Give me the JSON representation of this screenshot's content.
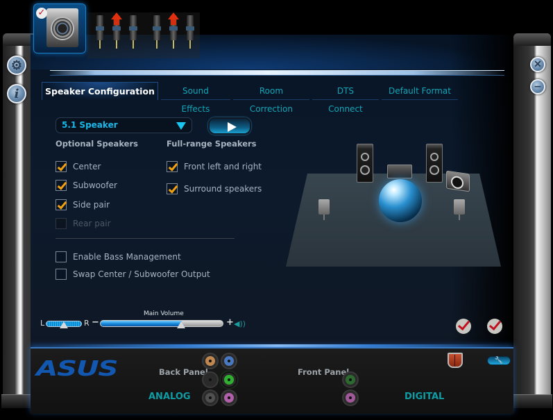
{
  "window": {
    "side_buttons_left": [
      {
        "name": "settings",
        "icon": "gear-icon",
        "glyph": "⚙"
      },
      {
        "name": "info",
        "icon": "info-icon",
        "glyph": "i"
      }
    ],
    "side_buttons_right": [
      {
        "name": "close",
        "icon": "close-icon",
        "glyph": "✕"
      },
      {
        "name": "minimize",
        "icon": "minimize-icon",
        "glyph": "−"
      }
    ]
  },
  "device": {
    "selected": "Speakers",
    "check_glyph": "✓",
    "jacks": [
      {
        "arrow": false
      },
      {
        "arrow": true
      },
      {
        "arrow": false
      },
      {
        "arrow": false
      },
      {
        "arrow": true
      },
      {
        "arrow": false
      }
    ]
  },
  "tabs": [
    {
      "label": "Speaker Configuration",
      "active": true
    },
    {
      "label": "Sound Effects",
      "active": false
    },
    {
      "label": "Room Correction",
      "active": false
    },
    {
      "label": "DTS Connect",
      "active": false
    },
    {
      "label": "Default Format",
      "active": false
    }
  ],
  "config": {
    "speaker_mode": "5.1 Speaker",
    "test_button": "play",
    "optional_heading": "Optional Speakers",
    "fullrange_heading": "Full-range Speakers",
    "optional": [
      {
        "label": "Center",
        "checked": true,
        "disabled": false
      },
      {
        "label": "Subwoofer",
        "checked": true,
        "disabled": false
      },
      {
        "label": "Side pair",
        "checked": true,
        "disabled": false
      },
      {
        "label": "Rear pair",
        "checked": false,
        "disabled": true
      }
    ],
    "fullrange": [
      {
        "label": "Front left and right",
        "checked": true
      },
      {
        "label": "Surround speakers",
        "checked": true
      }
    ],
    "options": [
      {
        "label": "Enable Bass Management",
        "checked": false
      },
      {
        "label": "Swap Center / Subwoofer Output",
        "checked": false
      }
    ]
  },
  "volume": {
    "balance_left": "L",
    "balance_right": "R",
    "balance_value": 0.5,
    "main_label": "Main Volume",
    "main_value": 0.66,
    "minus": "−",
    "plus": "+",
    "speaker_glyph": "◀))"
  },
  "bottom": {
    "brand": "ASUS",
    "back_panel": "Back Panel",
    "front_panel": "Front Panel",
    "analog": "ANALOG",
    "digital": "DIGITAL",
    "back_jacks": [
      {
        "color": "#c08850",
        "active": false
      },
      {
        "color": "#4a78c0",
        "active": false
      },
      {
        "color": "#2a2a2a",
        "active": false
      },
      {
        "color": "#30b030",
        "active": true
      },
      {
        "color": "#505050",
        "active": false
      },
      {
        "color": "#b060a8",
        "active": false
      }
    ],
    "front_jacks": [
      {
        "color": "#2c6a30",
        "active": false
      },
      {
        "color": "#a05898",
        "active": false
      }
    ],
    "wrench_glyph": "🔧"
  }
}
